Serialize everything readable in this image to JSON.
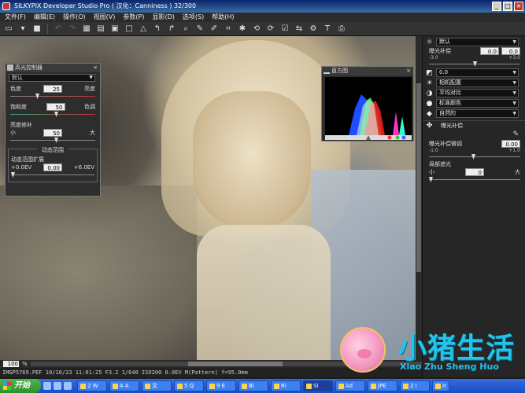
{
  "window": {
    "title": "SILKYPIX Developer Studio Pro ( 汉化：Canniness )    32/300",
    "min": "_",
    "max": "□",
    "close": "×"
  },
  "menu": [
    "文件(F)",
    "编辑(E)",
    "操作(O)",
    "视图(V)",
    "参数(P)",
    "显影(D)",
    "选项(S)",
    "帮助(H)"
  ],
  "toolbar_icons": [
    "folder-open-icon",
    "folder-dropdown-icon",
    "save-icon",
    "undo-icon",
    "redo-icon",
    "grid-view-icon",
    "combined-view-icon",
    "preview-view-icon",
    "fullscreen-icon",
    "warning-icon",
    "rotate-left-icon",
    "rotate-right-icon",
    "zoom-icon",
    "eyedropper-icon",
    "white-balance-picker-icon",
    "crop-icon",
    "spot-icon",
    "develop-icon",
    "reset-icon",
    "check-icon",
    "compare-icon",
    "settings-icon",
    "text-tool-icon",
    "print-icon"
  ],
  "highlight_panel": {
    "title": "高光控制器",
    "close": "×",
    "preset": "默认",
    "hue": {
      "left": "色度",
      "right": "亮度",
      "value": "25"
    },
    "saturation": {
      "left": "饱和度",
      "right": "色调",
      "value": "50"
    },
    "brightness": {
      "label": "亮度修补",
      "left": "小",
      "right": "大",
      "value": "50"
    },
    "dynamic_range": {
      "group": "动态范围",
      "label": "动态范围扩展",
      "min": "+0.0EV",
      "max": "+6.0EV",
      "value": "0.00"
    }
  },
  "histogram_panel": {
    "title": "直方图",
    "close": "×"
  },
  "right_panel": {
    "preset": "默认",
    "exposure": {
      "label": "曝光补偿",
      "value1": "0.0",
      "value2": "0.0",
      "min": "-3.0",
      "max": "+3.0"
    },
    "white_balance": "0.0",
    "contrast": "相机配置",
    "gamma": "平均对比",
    "color": "标准颜色",
    "sharpness": "自然的",
    "sub_label": "曝光补偿",
    "fine_adjust": {
      "label": "曝光补偿微调",
      "value": "0.00",
      "min": "-1.0",
      "max": "+1.0"
    },
    "local": {
      "label": "局部遮光",
      "value": "0",
      "min": "小",
      "max": "大"
    }
  },
  "status": {
    "zoom": "100",
    "zoom_unit": "%"
  },
  "info": "IMGP5769.PEF 10/10/23 11:01:25 F3.2 1/640 ISO200  0.0EV M(Pattern) f=95.0mm",
  "watermark": {
    "title": "小猪生活",
    "subtitle": "Xiao Zhu Sheng Huo"
  },
  "taskbar": {
    "start": "开始",
    "tasks": [
      "2 W",
      "4 A",
      "文",
      "5 Q",
      "9 E",
      "Bi",
      "Ri",
      "SI",
      "Ad",
      "JPE",
      "2 I",
      "Ir"
    ]
  }
}
